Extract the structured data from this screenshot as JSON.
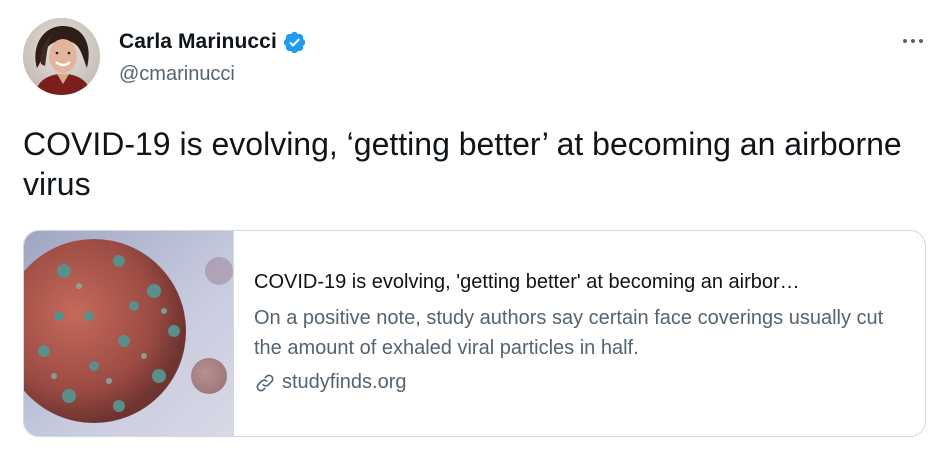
{
  "author": {
    "display_name": "Carla Marinucci",
    "handle": "@cmarinucci",
    "verified": true
  },
  "tweet": {
    "text": "COVID-19 is evolving, ‘getting better’ at becoming an airborne virus"
  },
  "card": {
    "title": "COVID-19 is evolving, 'getting better' at becoming an airbor…",
    "description": "On a positive note, study authors say certain face coverings usually cut the amount of exhaled viral particles in half.",
    "domain": "studyfinds.org"
  },
  "icons": {
    "verified": "verified-badge-icon",
    "more": "more-options-icon",
    "link": "link-icon"
  },
  "colors": {
    "primary_text": "#0f1419",
    "secondary_text": "#536471",
    "verified_blue": "#1d9bf0",
    "border": "#cfd9de"
  }
}
